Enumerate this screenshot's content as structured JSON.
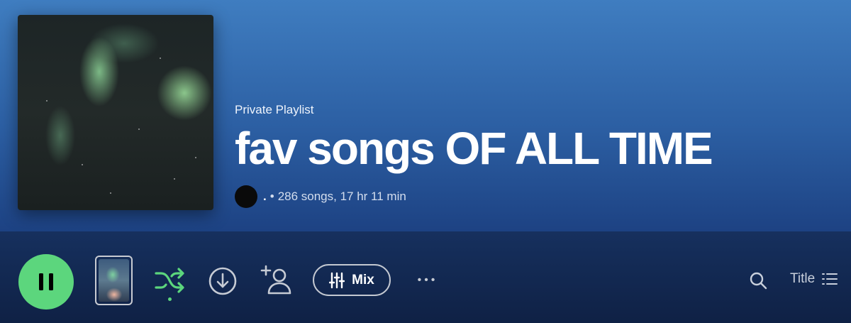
{
  "playlist": {
    "type_label": "Private Playlist",
    "title": "fav songs OF ALL TIME",
    "owner": ".",
    "separator": "•",
    "stats": "286 songs, 17 hr 11 min"
  },
  "controls": {
    "mix_label": "Mix",
    "sort_label": "Title",
    "more_label": "•••"
  },
  "colors": {
    "accent_green": "#5cd67d",
    "header_blue": "#3f7dc0",
    "bar_navy": "#0f2145"
  },
  "icons": [
    "pause-icon",
    "shuffle-icon",
    "download-icon",
    "add-user-icon",
    "mix-sliders-icon",
    "more-icon",
    "search-icon",
    "list-icon"
  ]
}
